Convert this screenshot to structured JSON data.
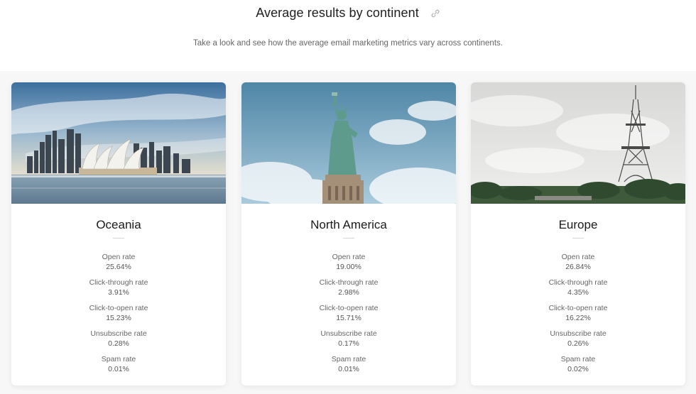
{
  "header": {
    "title": "Average results by continent",
    "subtitle": "Take a look and see how the average email marketing metrics vary across continents."
  },
  "cards": [
    {
      "name": "Oceania",
      "image": "sydney-opera-house-photo",
      "metrics": [
        {
          "label": "Open rate",
          "value": "25.64%"
        },
        {
          "label": "Click-through rate",
          "value": "3.91%"
        },
        {
          "label": "Click-to-open rate",
          "value": "15.23%"
        },
        {
          "label": "Unsubscribe rate",
          "value": "0.28%"
        },
        {
          "label": "Spam rate",
          "value": "0.01%"
        }
      ]
    },
    {
      "name": "North America",
      "image": "statue-of-liberty-photo",
      "metrics": [
        {
          "label": "Open rate",
          "value": "19.00%"
        },
        {
          "label": "Click-through rate",
          "value": "2.98%"
        },
        {
          "label": "Click-to-open rate",
          "value": "15.71%"
        },
        {
          "label": "Unsubscribe rate",
          "value": "0.17%"
        },
        {
          "label": "Spam rate",
          "value": "0.01%"
        }
      ]
    },
    {
      "name": "Europe",
      "image": "eiffel-tower-photo",
      "metrics": [
        {
          "label": "Open rate",
          "value": "26.84%"
        },
        {
          "label": "Click-through rate",
          "value": "4.35%"
        },
        {
          "label": "Click-to-open rate",
          "value": "16.22%"
        },
        {
          "label": "Unsubscribe rate",
          "value": "0.26%"
        },
        {
          "label": "Spam rate",
          "value": "0.02%"
        }
      ]
    }
  ]
}
